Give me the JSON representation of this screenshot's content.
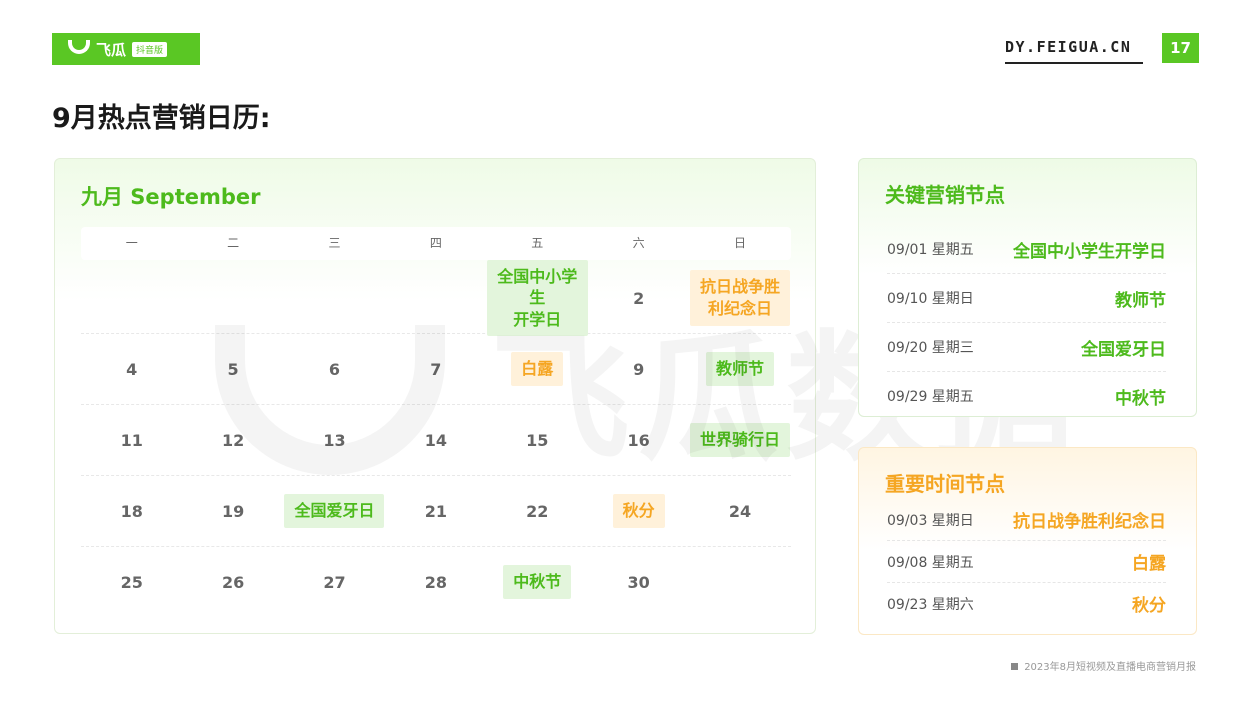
{
  "header": {
    "logo_text": "飞瓜",
    "logo_tag": "抖音版",
    "site": "DY.FEIGUA.CN",
    "page_number": "17"
  },
  "page_title": "9月热点营销日历:",
  "watermark": "飞瓜数据",
  "calendar": {
    "title": "九月 September",
    "weekdays": [
      "一",
      "二",
      "三",
      "四",
      "五",
      "六",
      "日"
    ],
    "rows": [
      [
        {
          "t": ""
        },
        {
          "t": ""
        },
        {
          "t": ""
        },
        {
          "t": ""
        },
        {
          "t": "全国中小学生\n开学日",
          "s": "g"
        },
        {
          "t": "2"
        },
        {
          "t": "抗日战争胜\n利纪念日",
          "s": "o"
        }
      ],
      [
        {
          "t": "4"
        },
        {
          "t": "5"
        },
        {
          "t": "6"
        },
        {
          "t": "7"
        },
        {
          "t": "白露",
          "s": "o"
        },
        {
          "t": "9"
        },
        {
          "t": "教师节",
          "s": "g"
        }
      ],
      [
        {
          "t": "11"
        },
        {
          "t": "12"
        },
        {
          "t": "13"
        },
        {
          "t": "14"
        },
        {
          "t": "15"
        },
        {
          "t": "16"
        },
        {
          "t": "世界骑行日",
          "s": "g"
        }
      ],
      [
        {
          "t": "18"
        },
        {
          "t": "19"
        },
        {
          "t": "全国爱牙日",
          "s": "g"
        },
        {
          "t": "21"
        },
        {
          "t": "22"
        },
        {
          "t": "秋分",
          "s": "o"
        },
        {
          "t": "24"
        }
      ],
      [
        {
          "t": "25"
        },
        {
          "t": "26"
        },
        {
          "t": "27"
        },
        {
          "t": "28"
        },
        {
          "t": "中秋节",
          "s": "g"
        },
        {
          "t": "30"
        },
        {
          "t": ""
        }
      ]
    ]
  },
  "key_points": {
    "title": "关键营销节点",
    "items": [
      {
        "date": "09/01  星期五",
        "name": "全国中小学生开学日"
      },
      {
        "date": "09/10  星期日",
        "name": "教师节"
      },
      {
        "date": "09/20 星期三",
        "name": "全国爱牙日"
      },
      {
        "date": "09/29  星期五",
        "name": "中秋节"
      }
    ]
  },
  "important_points": {
    "title": "重要时间节点",
    "items": [
      {
        "date": "09/03  星期日",
        "name": "抗日战争胜利纪念日"
      },
      {
        "date": "09/08  星期五",
        "name": "白露"
      },
      {
        "date": "09/23  星期六",
        "name": "秋分"
      }
    ]
  },
  "footer": "2023年8月短视频及直播电商营销月报"
}
